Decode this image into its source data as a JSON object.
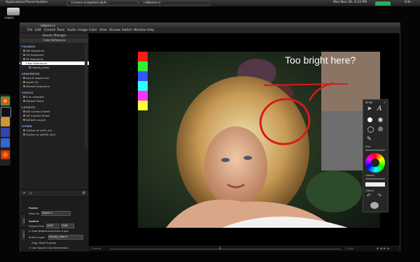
{
  "top_panel": {
    "applications": "Applications",
    "places": "Places",
    "system": "System",
    "task_browser": "[cinenc-snapshot.djv0-...",
    "task_app": "rvbbone.rv",
    "datetime": "Mon Nov 26, 4:23 PM",
    "user": "Erik"
  },
  "desktop": {
    "hd_label": "rvbbit"
  },
  "window": {
    "title": "rvbbone.rv",
    "menu": [
      "File",
      "Edit",
      "Control",
      "Tools",
      "Audio",
      "Image",
      "Color",
      "View",
      "Review",
      "Switch",
      "Window",
      "Help"
    ]
  },
  "browser": {
    "title": "Session Manager",
    "subtitle": "Color Reference",
    "sections": [
      {
        "label": "FOLDERS",
        "items": [
          "AW Sequence",
          "GR Sequence",
          "SE Sequence",
          "Color Reference",
          "mando_clean"
        ]
      },
      {
        "label": "SEQUENCES",
        "items": [
          "seq of sequences",
          "seo00 00",
          "Default Sequence"
        ]
      },
      {
        "label": "STACKS",
        "items": [
          "A vs compare",
          "Default Stack"
        ]
      },
      {
        "label": "LAYOUTS",
        "items": [
          "AW Contact Sheet",
          "GR Contact Sheet",
          "Default Layout"
        ]
      },
      {
        "label": "OTHER",
        "items": [
          "Outline of ssi02_fn4",
          "Outline of sei090_fb11"
        ]
      }
    ],
    "selected_item": "Color Reference"
  },
  "props": {
    "folder_label": "Folder",
    "view_as_label": "View As",
    "view_as_value": "Switch",
    "switch_label": "Switch",
    "output_size_label": "Output Size",
    "output_w": "1920",
    "output_h": "1080",
    "size_determined": "Size Determined from Input",
    "active_input_label": "Active Input",
    "active_input_value": "mando_clean",
    "align_start": "Align Start Frames",
    "use_source_cut": "Use Source Cut Information",
    "tab_edit": "Edit",
    "tab_color": "Color"
  },
  "viewer": {
    "annotation_text": "Too bright here?",
    "swatch_colors": [
      "#ff1a1a",
      "#33ee33",
      "#3355ff",
      "#33ffff",
      "#ff33ff",
      "#ffff33"
    ],
    "annotation_color": "#d81a1a"
  },
  "timeline": {
    "frame_start": "1 frames",
    "frame_marker": "1",
    "frame_end": "1.0000"
  },
  "draw_tools": {
    "title": "Draw",
    "size_label": "Size",
    "opacity_label": "Opacity",
    "history_label": "History",
    "text_tool": "A"
  }
}
